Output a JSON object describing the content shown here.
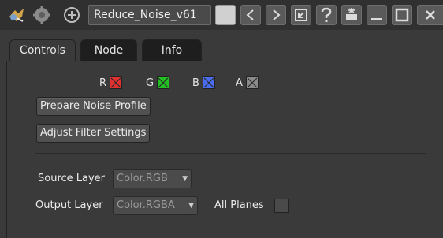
{
  "toolbar": {
    "node_name": "Reduce_Noise_v61",
    "icons": [
      "node-icon",
      "gear-icon",
      "add-circle-icon"
    ],
    "buttons": [
      {
        "name": "prev-button",
        "glyph": "<",
        "icon": "chevron-left-icon"
      },
      {
        "name": "next-button",
        "glyph": ">",
        "icon": "chevron-right-icon"
      },
      {
        "name": "revert-button",
        "glyph": "↺",
        "icon": "revert-icon"
      },
      {
        "name": "help-button",
        "glyph": "?",
        "icon": "question-icon"
      },
      {
        "name": "float-button",
        "glyph": "✱",
        "icon": "float-icon"
      },
      {
        "name": "minimize-button",
        "glyph": "_",
        "icon": "minimize-icon"
      },
      {
        "name": "maximize-button",
        "glyph": "□",
        "icon": "maximize-icon"
      },
      {
        "name": "close-button",
        "glyph": "✕",
        "icon": "close-icon"
      }
    ]
  },
  "tabs": [
    "Controls",
    "Node",
    "Info"
  ],
  "active_tab": "Controls",
  "channels": [
    {
      "label": "R",
      "color": "#e03030"
    },
    {
      "label": "G",
      "color": "#22c022"
    },
    {
      "label": "B",
      "color": "#4a6cf0"
    },
    {
      "label": "A",
      "color": "#8a8a8a"
    }
  ],
  "buttons": {
    "prepare": "Prepare Noise Profile",
    "adjust": "Adjust Filter Settings"
  },
  "source_layer": {
    "label": "Source Layer",
    "value": "Color.RGB"
  },
  "output_layer": {
    "label": "Output Layer",
    "value": "Color.RGBA"
  },
  "all_planes": {
    "label": "All Planes",
    "checked": false
  },
  "colors": {
    "background": "#3a3a3a",
    "toolbar": "#303030",
    "button": "#515151"
  }
}
